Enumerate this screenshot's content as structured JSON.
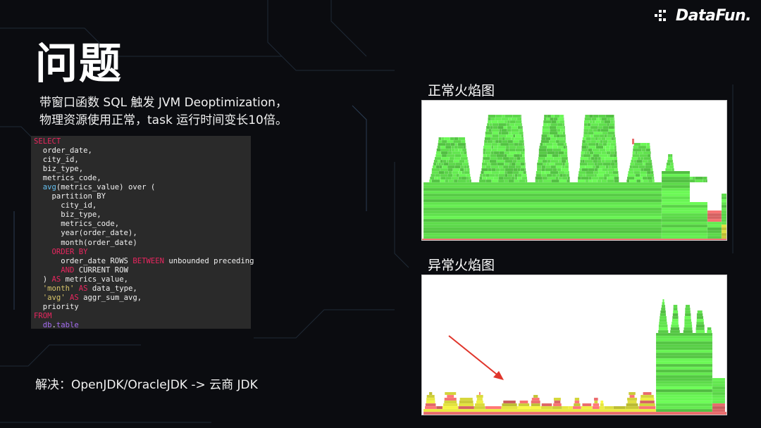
{
  "logo": {
    "text": "DataFun."
  },
  "title": "问题",
  "description": {
    "line1": "带窗口函数 SQL 触发 JVM Deoptimization，",
    "line2": "物理资源使用正常，task 运行时间变长10倍。"
  },
  "code_lines": [
    [
      [
        "kw",
        "SELECT"
      ]
    ],
    [
      [
        "txt",
        "  order_date,"
      ]
    ],
    [
      [
        "txt",
        "  city_id,"
      ]
    ],
    [
      [
        "txt",
        "  biz_type,"
      ]
    ],
    [
      [
        "txt",
        "  metrics_code,"
      ]
    ],
    [
      [
        "fn",
        "  avg"
      ],
      [
        "txt",
        "(metrics_value) over ("
      ]
    ],
    [
      [
        "txt",
        "    partition BY"
      ]
    ],
    [
      [
        "txt",
        "      city_id,"
      ]
    ],
    [
      [
        "txt",
        "      biz_type,"
      ]
    ],
    [
      [
        "txt",
        "      metrics_code,"
      ]
    ],
    [
      [
        "txt",
        "      year(order_date),"
      ]
    ],
    [
      [
        "txt",
        "      month(order_date)"
      ]
    ],
    [
      [
        "kw",
        "    ORDER BY"
      ]
    ],
    [
      [
        "txt",
        "      order_date ROWS "
      ],
      [
        "kw",
        "BETWEEN"
      ],
      [
        "txt",
        " unbounded preceding"
      ]
    ],
    [
      [
        "kw",
        "      AND"
      ],
      [
        "txt",
        " CURRENT ROW"
      ]
    ],
    [
      [
        "txt",
        "  ) "
      ],
      [
        "kw",
        "AS"
      ],
      [
        "txt",
        " metrics_value,"
      ]
    ],
    [
      [
        "str",
        "  'month'"
      ],
      [
        "kw",
        " AS"
      ],
      [
        "txt",
        " data_type,"
      ]
    ],
    [
      [
        "str",
        "  'avg'"
      ],
      [
        "kw",
        " AS"
      ],
      [
        "txt",
        " aggr_sum_avg,"
      ]
    ],
    [
      [
        "txt",
        "  priority"
      ]
    ],
    [
      [
        "kw",
        "FROM"
      ]
    ],
    [
      [
        "tbl",
        "  db"
      ],
      [
        "txt",
        "."
      ],
      [
        "tbl",
        "table"
      ]
    ]
  ],
  "solution": "解决：OpenJDK/OracleJDK -> 云商 JDK",
  "normal_flamegraph": {
    "label": "正常火焰图"
  },
  "abnormal_flamegraph": {
    "label": "异常火焰图"
  },
  "colors": {
    "flame_green": "#5ddc4a",
    "flame_yellow": "#dada3a",
    "flame_red": "#e86a6a",
    "arrow_red": "#e0352b"
  }
}
